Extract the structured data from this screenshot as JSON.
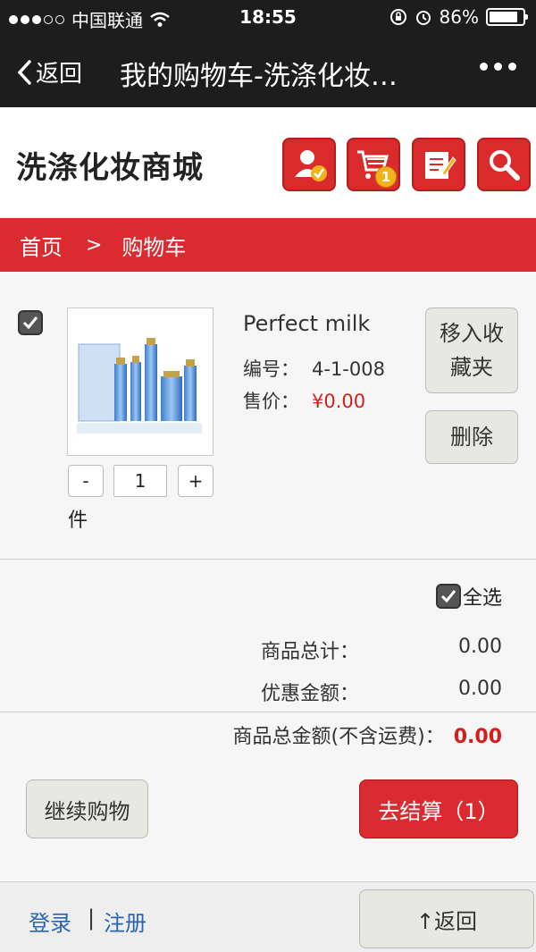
{
  "status_bar": {
    "carrier": "中国联通",
    "time": "18:55",
    "battery": "86%",
    "battery_level": 0.86
  },
  "nav": {
    "back_label": "返回",
    "title": "我的购物车-洗涤化妆…"
  },
  "header": {
    "shop_name": "洗涤化妆商城",
    "cart_count": "1",
    "icons": [
      "user-check-icon",
      "cart-icon",
      "edit-icon",
      "search-icon"
    ]
  },
  "breadcrumb": {
    "home": "首页",
    "separator": ">",
    "current": "购物车"
  },
  "item": {
    "name": "Perfect milk",
    "code_label": "编号：",
    "code": "4-1-008",
    "price_label": "售价：",
    "price": "¥0.00",
    "minus": "-",
    "quantity": "1",
    "plus": "+",
    "unit": "件",
    "favorite_label": "移入收藏夹",
    "delete_label": "删除"
  },
  "summary": {
    "select_all": "全选",
    "goods_total_label": "商品总计：",
    "goods_total": "0.00",
    "discount_label": "优惠金额：",
    "discount": "0.00",
    "grand_total_label": "商品总金额(不含运费)：",
    "grand_total": "0.00"
  },
  "actions": {
    "continue_label": "继续购物",
    "checkout_label": "去结算（1）"
  },
  "footer": {
    "login": "登录",
    "separator": "|",
    "register": "注册",
    "back_top": "↑返回"
  },
  "colors": {
    "brand_red": "#d92b30",
    "price_red": "#d31e1e",
    "link_blue": "#2a64b8",
    "dark_bar": "#1d1d1d"
  }
}
